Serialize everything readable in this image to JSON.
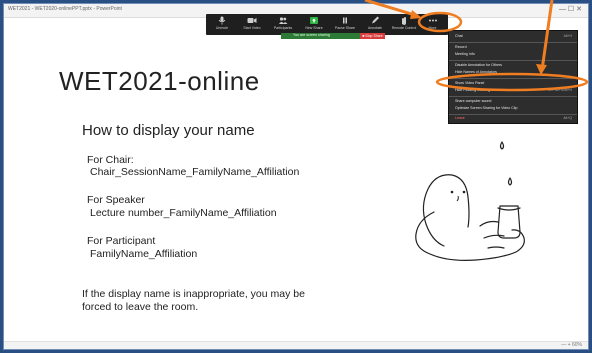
{
  "window": {
    "title": "WET2021 - WET2020-onlinePPT.pptx - PowerPoint",
    "controls": "—  ☐  ✕"
  },
  "toolbar": {
    "buttons": [
      {
        "label": "Unmute",
        "icon": "mic-icon"
      },
      {
        "label": "Start Video",
        "icon": "camera-icon"
      },
      {
        "label": "Participants",
        "icon": "people-icon",
        "count": "2"
      },
      {
        "label": "New Share",
        "icon": "share-icon"
      },
      {
        "label": "Pause Share",
        "icon": "pause-icon"
      },
      {
        "label": "Annotate",
        "icon": "pen-icon"
      },
      {
        "label": "Remote Control",
        "icon": "hand-icon"
      },
      {
        "label": "More",
        "icon": "more-icon"
      }
    ],
    "sharing_message": "You are screen sharing",
    "stop_share_label": "■ Stop Share"
  },
  "more_menu": {
    "items": [
      {
        "label": "Chat",
        "shortcut": "Alt+H"
      },
      {
        "label": "Record",
        "shortcut": ""
      },
      {
        "label": "Meeting Info",
        "shortcut": ""
      },
      {
        "label": "Disable Annotation for Others",
        "shortcut": ""
      },
      {
        "label": "Hide Names of Annotators",
        "shortcut": ""
      },
      {
        "label": "Show Video Panel",
        "shortcut": ""
      },
      {
        "label": "Hide Floating Meeting Controls",
        "shortcut": "Ctrl+Alt+Shift+H"
      },
      {
        "label": "Share computer sound",
        "shortcut": ""
      },
      {
        "label": "Optimize Screen Sharing for Video Clip",
        "shortcut": ""
      },
      {
        "label": "Leave",
        "shortcut": "Alt+Q"
      }
    ]
  },
  "slide": {
    "title": "WET2021-online",
    "subtitle": "How to display your name",
    "sections": [
      {
        "label": "For Chair:",
        "value": "Chair_SessionName_FamilyName_Affiliation"
      },
      {
        "label": "For Speaker",
        "value": "Lecture number_FamilyName_Affiliation"
      },
      {
        "label": "For Participant",
        "value": "FamilyName_Affiliation"
      }
    ],
    "note_line1": "If the display name is inappropriate, you may be",
    "note_line2": "forced to leave the room."
  },
  "status": {
    "zoom": "— + 60%"
  },
  "colors": {
    "highlight": "#ef7d22",
    "share_green": "#2c7a35",
    "stop_red": "#d93b3b",
    "toolbar_bg": "#1f1f1f"
  }
}
